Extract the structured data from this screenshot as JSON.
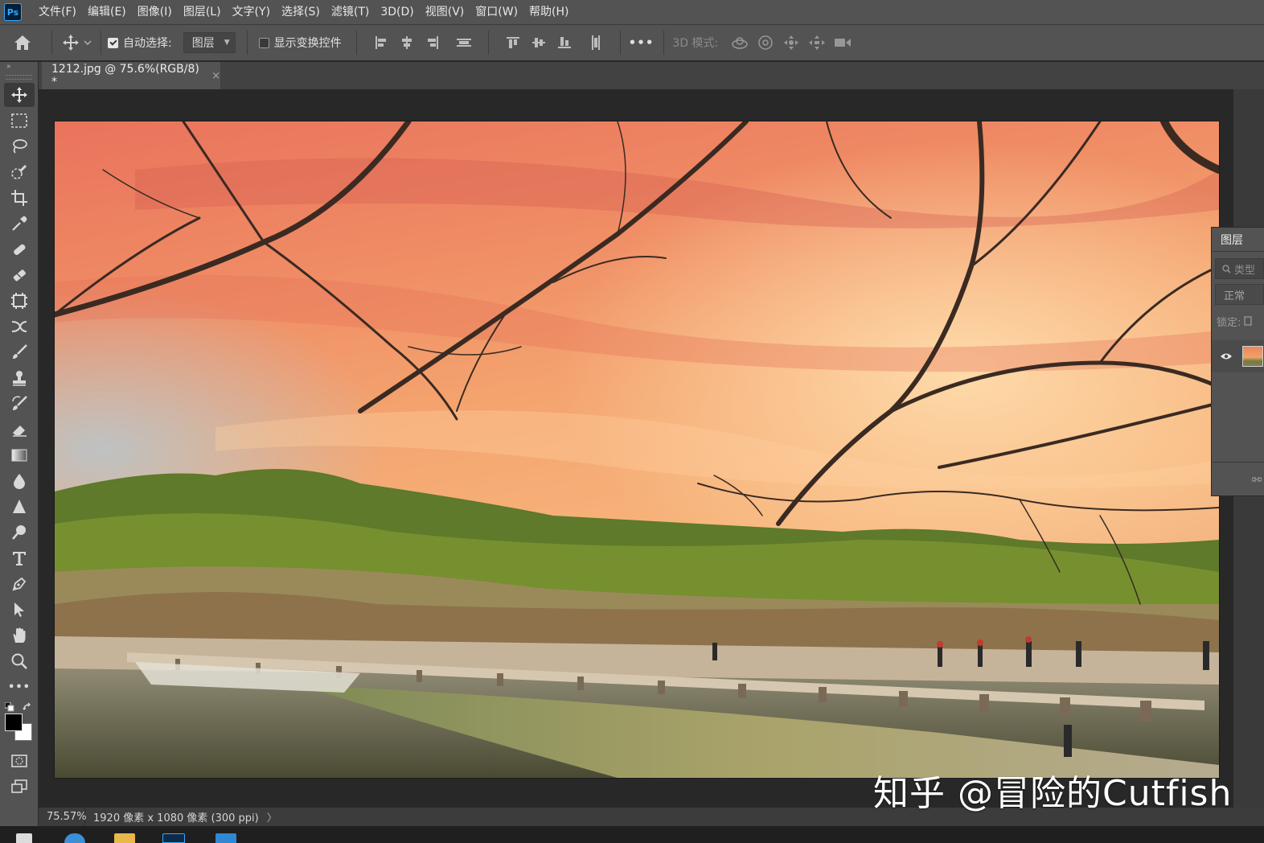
{
  "app": {
    "logo_text": "Ps"
  },
  "menu": {
    "items": [
      {
        "id": "file",
        "label": "文件(F)"
      },
      {
        "id": "edit",
        "label": "编辑(E)"
      },
      {
        "id": "image",
        "label": "图像(I)"
      },
      {
        "id": "layer",
        "label": "图层(L)"
      },
      {
        "id": "type",
        "label": "文字(Y)"
      },
      {
        "id": "select",
        "label": "选择(S)"
      },
      {
        "id": "filter",
        "label": "滤镜(T)"
      },
      {
        "id": "3d",
        "label": "3D(D)"
      },
      {
        "id": "view",
        "label": "视图(V)"
      },
      {
        "id": "window",
        "label": "窗口(W)"
      },
      {
        "id": "help",
        "label": "帮助(H)"
      }
    ]
  },
  "options": {
    "auto_select_label": "自动选择:",
    "auto_select_checked": true,
    "auto_select_target": "图层",
    "show_transform_label": "显示变换控件",
    "show_transform_checked": false,
    "more_label": "•••",
    "mode_3d_label": "3D 模式:"
  },
  "document": {
    "tab_title": "1212.jpg @ 75.6%(RGB/8) *",
    "tab_close": "×"
  },
  "toolbar": {
    "collapse_glyph": "»",
    "more_glyph": "•••"
  },
  "layers_panel": {
    "tab_label": "图层",
    "filter_placeholder": "类型",
    "blend_mode": "正常",
    "lock_label": "锁定:"
  },
  "status": {
    "zoom": "75.57%",
    "doc_info": "1920 像素 x 1080 像素 (300 ppi)",
    "arrow": "〉"
  },
  "watermark": {
    "text": "知乎 @冒险的Cutfish"
  },
  "colors": {
    "ui_panel": "#535353",
    "ui_dark": "#282828",
    "accent_blue": "#31a8ff",
    "foreground_swatch": "#000000",
    "background_swatch": "#ffffff"
  }
}
